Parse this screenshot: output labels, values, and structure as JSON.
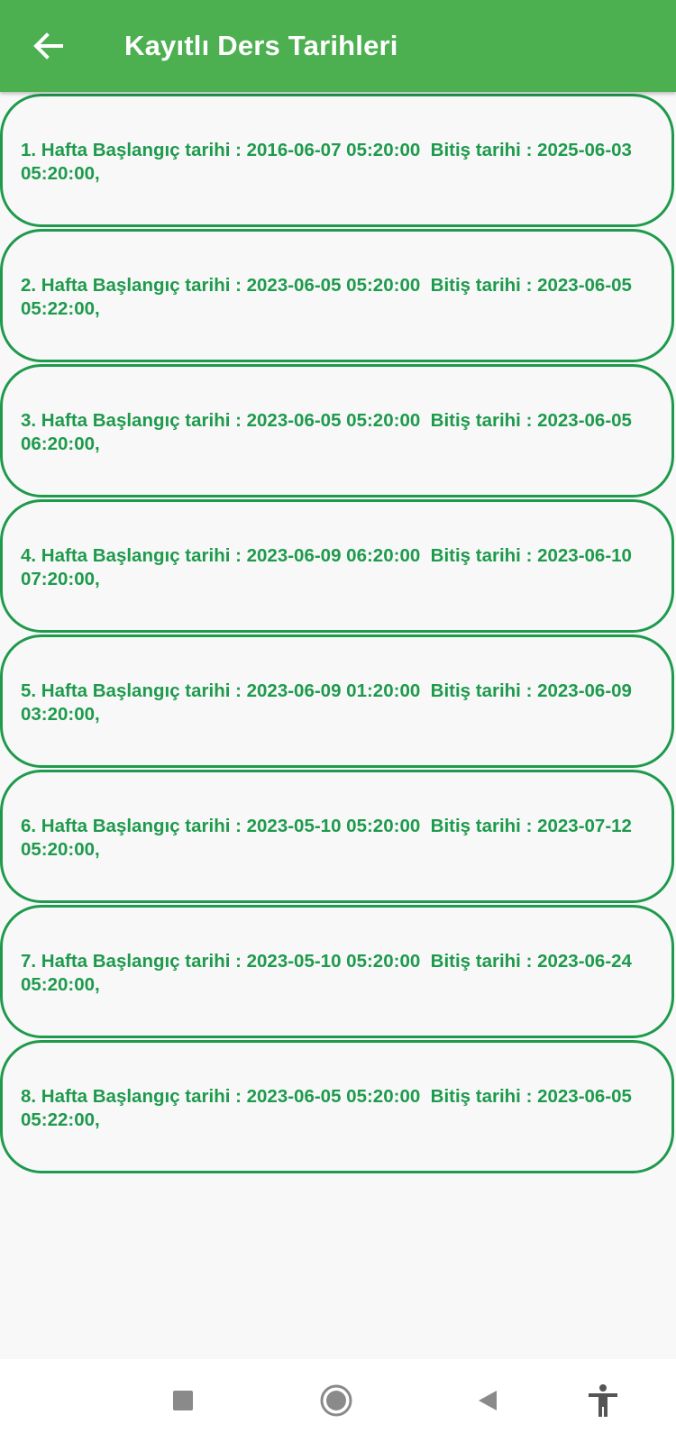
{
  "app_bar": {
    "title": "Kayıtlı Ders Tarihleri",
    "back_icon": "arrow-left-icon",
    "background": "#4caf50"
  },
  "entries": [
    {
      "text": "1. Hafta Başlangıç tarihi : 2016-06-07 05:20:00  Bitiş tarihi : 2025-06-03 05:20:00,"
    },
    {
      "text": "2. Hafta Başlangıç tarihi : 2023-06-05 05:20:00  Bitiş tarihi : 2023-06-05 05:22:00,"
    },
    {
      "text": "3. Hafta Başlangıç tarihi : 2023-06-05 05:20:00  Bitiş tarihi : 2023-06-05 06:20:00,"
    },
    {
      "text": "4. Hafta Başlangıç tarihi : 2023-06-09 06:20:00  Bitiş tarihi : 2023-06-10 07:20:00,"
    },
    {
      "text": "5. Hafta Başlangıç tarihi : 2023-06-09 01:20:00  Bitiş tarihi : 2023-06-09 03:20:00,"
    },
    {
      "text": "6. Hafta Başlangıç tarihi : 2023-05-10 05:20:00  Bitiş tarihi : 2023-07-12 05:20:00,"
    },
    {
      "text": "7. Hafta Başlangıç tarihi : 2023-05-10 05:20:00  Bitiş tarihi : 2023-06-24 05:20:00,"
    },
    {
      "text": "8. Hafta Başlangıç tarihi : 2023-06-05 05:20:00  Bitiş tarihi : 2023-06-05 05:22:00,"
    }
  ],
  "nav_bar": {
    "buttons": [
      "recents-square-icon",
      "home-circle-icon",
      "back-triangle-icon",
      "accessibility-icon"
    ]
  },
  "colors": {
    "accent": "#1e9a4c",
    "app_bar": "#4caf50",
    "background": "#f8f8f8"
  }
}
